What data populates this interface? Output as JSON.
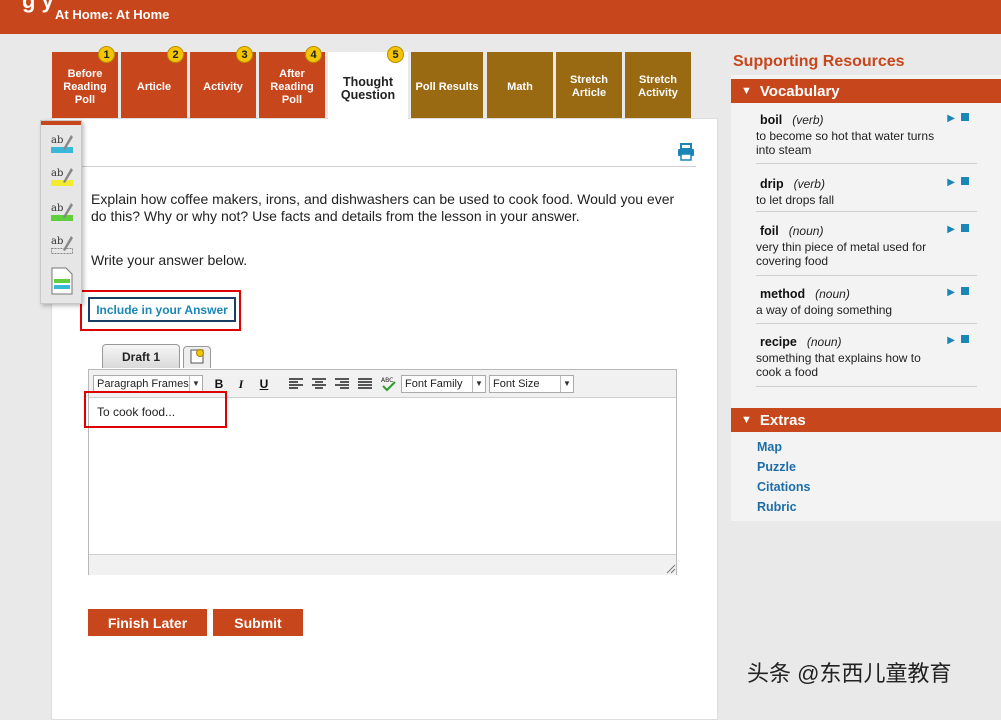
{
  "header": {
    "title": "g y",
    "breadcrumb": "At Home: At Home"
  },
  "tabs": [
    {
      "label": "Before Reading Poll",
      "num": "1"
    },
    {
      "label": "Article",
      "num": "2"
    },
    {
      "label": "Activity",
      "num": "3"
    },
    {
      "label": "After Reading Poll",
      "num": "4"
    },
    {
      "label": "Thought Question",
      "num": "5"
    },
    {
      "label": "Poll Results"
    },
    {
      "label": "Math"
    },
    {
      "label": "Stretch Article"
    },
    {
      "label": "Stretch Activity"
    }
  ],
  "question": {
    "prompt": "Explain how coffee makers, irons, and dishwashers can be used to cook food. Would you ever do this? Why or why not? Use facts and details from the lesson in your answer.",
    "instruction": "Write your answer below.",
    "include_button": "Include in your Answer"
  },
  "editor": {
    "draft_tab": "Draft 1",
    "paragraph_select": "Paragraph Frames",
    "font_family_select": "Font Family",
    "font_size_select": "Font Size",
    "bold": "B",
    "italic": "I",
    "underline": "U",
    "content": "To cook food..."
  },
  "actions": {
    "finish_later": "Finish Later",
    "submit": "Submit"
  },
  "sidebar": {
    "title": "Supporting Resources",
    "vocabulary_header": "Vocabulary",
    "vocabulary": [
      {
        "word": "boil",
        "pos": "(verb)",
        "def": "to become so hot that water turns into steam"
      },
      {
        "word": "drip",
        "pos": "(verb)",
        "def": "to let drops fall"
      },
      {
        "word": "foil",
        "pos": "(noun)",
        "def": "very thin piece of metal used for covering food"
      },
      {
        "word": "method",
        "pos": "(noun)",
        "def": "a way of doing something"
      },
      {
        "word": "recipe",
        "pos": "(noun)",
        "def": "something that explains how to cook a food"
      }
    ],
    "extras_header": "Extras",
    "extras": [
      "Map",
      "Puzzle",
      "Citations",
      "Rubric"
    ]
  },
  "watermark": "头条 @东西儿童教育",
  "colors": {
    "accent": "#c8461b",
    "brown": "#9a6a13",
    "link": "#1d6ea8",
    "badge": "#f4c400"
  },
  "icons": [
    "highlighter-blue-icon",
    "highlighter-yellow-icon",
    "highlighter-green-icon",
    "highlighter-clear-icon",
    "notes-icon",
    "print-icon",
    "spellcheck-icon",
    "sticky-note-icon"
  ]
}
